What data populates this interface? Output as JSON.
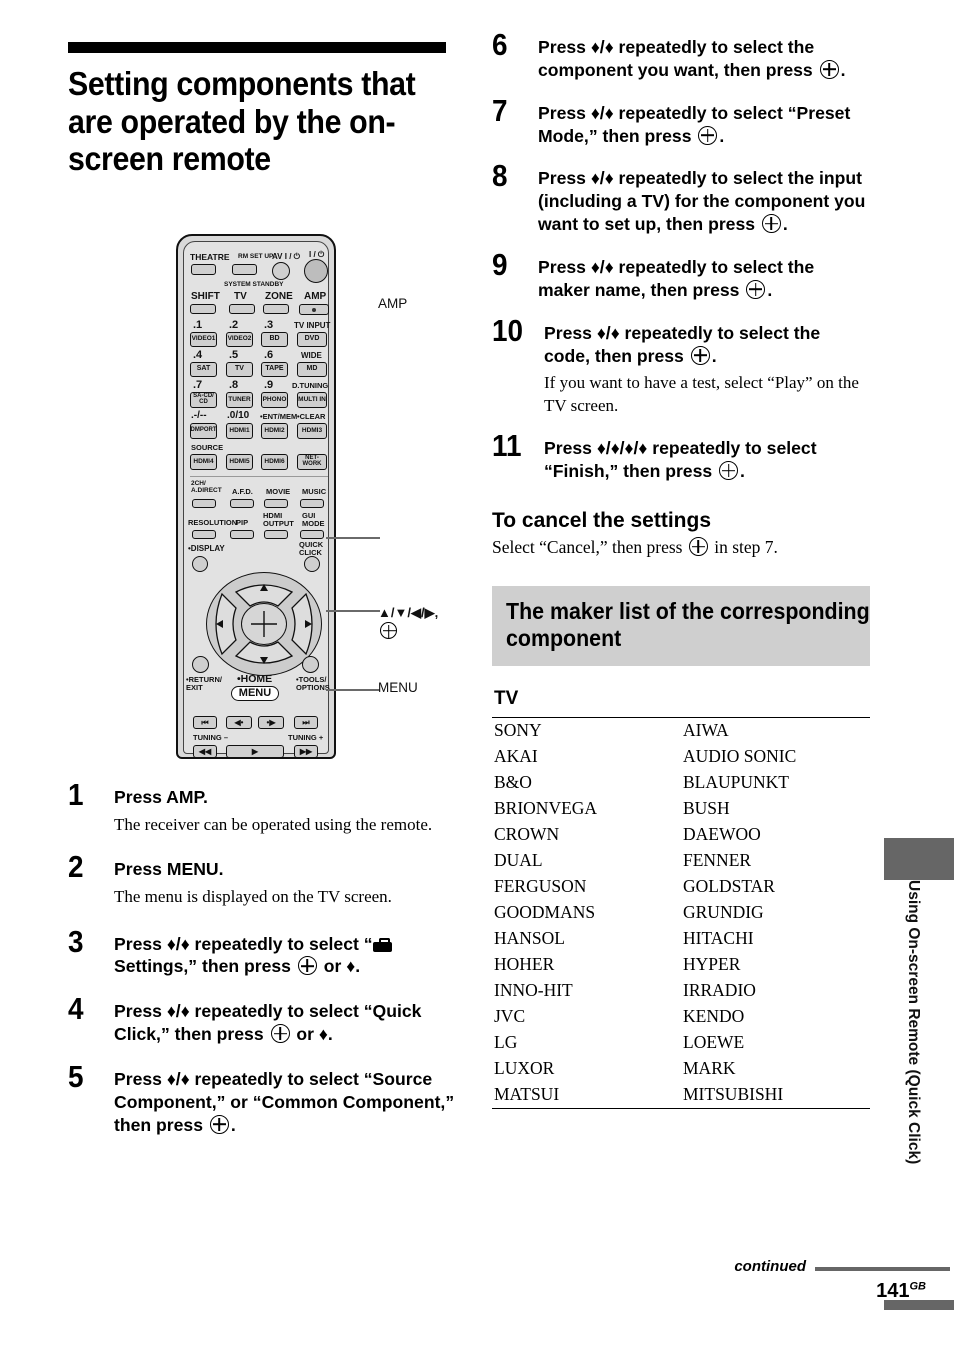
{
  "document": {
    "title": "Setting components that are operated by the on-screen remote",
    "page_number": "141",
    "page_region": "GB",
    "continued_label": "continued",
    "side_tab_label": "Using On-screen Remote (Quick Click)"
  },
  "remote": {
    "top_labels": {
      "theatre": "THEATRE",
      "rm_setup": "RM SET UP",
      "av": "AV I / ⏻",
      "power": "I / ⏻",
      "system_standby": "SYSTEM STANDBY"
    },
    "mode_row": [
      "SHIFT",
      "TV",
      "ZONE",
      "AMP"
    ],
    "numeric_rows": [
      {
        "nums": [
          ".1",
          ".2",
          ".3",
          "TV INPUT"
        ],
        "keys": [
          "VIDEO1",
          "VIDEO2",
          "BD",
          "DVD"
        ]
      },
      {
        "nums": [
          ".4",
          ".5",
          ".6",
          "WIDE"
        ],
        "keys": [
          "SAT",
          "TV",
          "TAPE",
          "MD"
        ]
      },
      {
        "nums": [
          ".7",
          ".8",
          ".9",
          "D.TUNING"
        ],
        "keys": [
          "SA-CD/ CD",
          "TUNER",
          "PHONO",
          "MULTI IN"
        ]
      },
      {
        "nums": [
          ".-/--",
          ".0/10",
          "•ENT/MEM",
          "•CLEAR"
        ],
        "keys": [
          "DMPORT",
          "HDMI1",
          "HDMI2",
          "HDMI3"
        ]
      }
    ],
    "source_label": "SOURCE",
    "source_keys": [
      "HDMI4",
      "HDMI5",
      "HDMI6",
      "NET- WORK"
    ],
    "sound_labels": [
      "2CH/ A.DIRECT",
      "A.F.D.",
      "MOVIE",
      "MUSIC"
    ],
    "func_labels": [
      "RESOLUTION",
      "PIP",
      "HDMI OUTPUT",
      "GUI MODE"
    ],
    "display_label": "•DISPLAY",
    "quick_click_label": "QUICK CLICK",
    "return_label": "•RETURN/ EXIT",
    "tools_label": "•TOOLS/ OPTIONS",
    "home_label": "•HOME",
    "menu_key_label": "MENU",
    "transport": [
      "⏮",
      "◀•",
      "•▶",
      "⏭"
    ],
    "tuning_minus": "TUNING –",
    "tuning_plus": "TUNING +",
    "callouts": [
      {
        "id": "amp",
        "label": "AMP"
      },
      {
        "id": "dpad",
        "label": "♦/♦/♦/♦,"
      },
      {
        "id": "menu",
        "label": "MENU"
      }
    ]
  },
  "steps_left": [
    {
      "num": "1",
      "body": "Press AMP.",
      "note": "The receiver can be operated using the remote."
    },
    {
      "num": "2",
      "body": "Press MENU.",
      "note": "The menu is displayed on the TV screen."
    },
    {
      "num": "3",
      "body_pre": "Press ♦/♦ repeatedly to select “",
      "body_mid": "Settings,” then press ",
      "body_post": " or ♦."
    },
    {
      "num": "4",
      "body_pre": "Press ♦/♦ repeatedly to select “Quick Click,” then press ",
      "body_post": " or ♦."
    },
    {
      "num": "5",
      "body_pre": "Press ♦/♦ repeatedly to select “Source Component,” or “Common Component,” then press ",
      "body_post": "."
    }
  ],
  "steps_right": [
    {
      "num": "6",
      "body_pre": "Press ♦/♦ repeatedly to select the component you want, then press ",
      "body_post": "."
    },
    {
      "num": "7",
      "body_pre": "Press ♦/♦ repeatedly to select “Preset Mode,” then press ",
      "body_post": "."
    },
    {
      "num": "8",
      "body_pre": "Press ♦/♦ repeatedly to select the input (including a TV) for the component you want to set up, then press ",
      "body_post": "."
    },
    {
      "num": "9",
      "body_pre": "Press ♦/♦ repeatedly to select the maker name, then press ",
      "body_post": "."
    },
    {
      "num": "10",
      "body_pre": "Press ♦/♦ repeatedly to select the code, then press ",
      "body_post": ".",
      "note": "If you want to have a test, select “Play” on the TV screen."
    },
    {
      "num": "11",
      "body_pre": "Press ♦/♦/♦/♦ repeatedly to select “Finish,” then press ",
      "body_post": "."
    }
  ],
  "cancel_section": {
    "heading": "To cancel the settings",
    "text_pre": "Select “Cancel,” then press ",
    "text_post": " in step 7."
  },
  "maker_list": {
    "heading": "The maker list of the corresponding component",
    "category": "TV",
    "rows": [
      [
        "SONY",
        "AIWA"
      ],
      [
        "AKAI",
        "AUDIO SONIC"
      ],
      [
        "B&O",
        "BLAUPUNKT"
      ],
      [
        "BRIONVEGA",
        "BUSH"
      ],
      [
        "CROWN",
        "DAEWOO"
      ],
      [
        "DUAL",
        "FENNER"
      ],
      [
        "FERGUSON",
        "GOLDSTAR"
      ],
      [
        "GOODMANS",
        "GRUNDIG"
      ],
      [
        "HANSOL",
        "HITACHI"
      ],
      [
        "HOHER",
        "HYPER"
      ],
      [
        "INNO-HIT",
        "IRRADIO"
      ],
      [
        "JVC",
        "KENDO"
      ],
      [
        "LG",
        "LOEWE"
      ],
      [
        "LUXOR",
        "MARK"
      ],
      [
        "MATSUI",
        "MITSUBISHI"
      ]
    ]
  },
  "colors": {
    "tab_gray": "#666666",
    "box_gray": "#cfcfcf",
    "rule_black": "#000000"
  }
}
